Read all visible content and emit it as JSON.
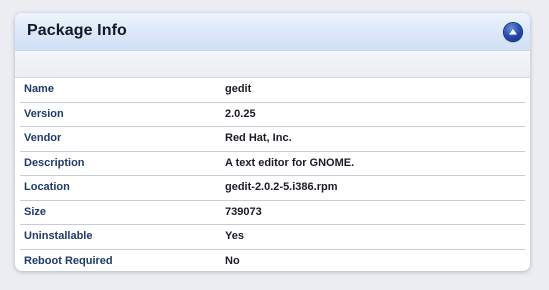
{
  "panel": {
    "title": "Package Info",
    "collapse_icon": "chevron-up-icon"
  },
  "rows": [
    {
      "label": "Name",
      "value": "gedit"
    },
    {
      "label": "Version",
      "value": "2.0.25"
    },
    {
      "label": "Vendor",
      "value": "Red Hat, Inc."
    },
    {
      "label": "Description",
      "value": "A text editor for GNOME."
    },
    {
      "label": "Location",
      "value": "gedit-2.0.2-5.i386.rpm"
    },
    {
      "label": "Size",
      "value": "739073"
    },
    {
      "label": "Uninstallable",
      "value": "Yes"
    },
    {
      "label": "Reboot Required",
      "value": "No"
    }
  ],
  "colors": {
    "header_bg": "#dbe7f8",
    "label_text": "#1f3a6b",
    "button": "#2147a8"
  }
}
